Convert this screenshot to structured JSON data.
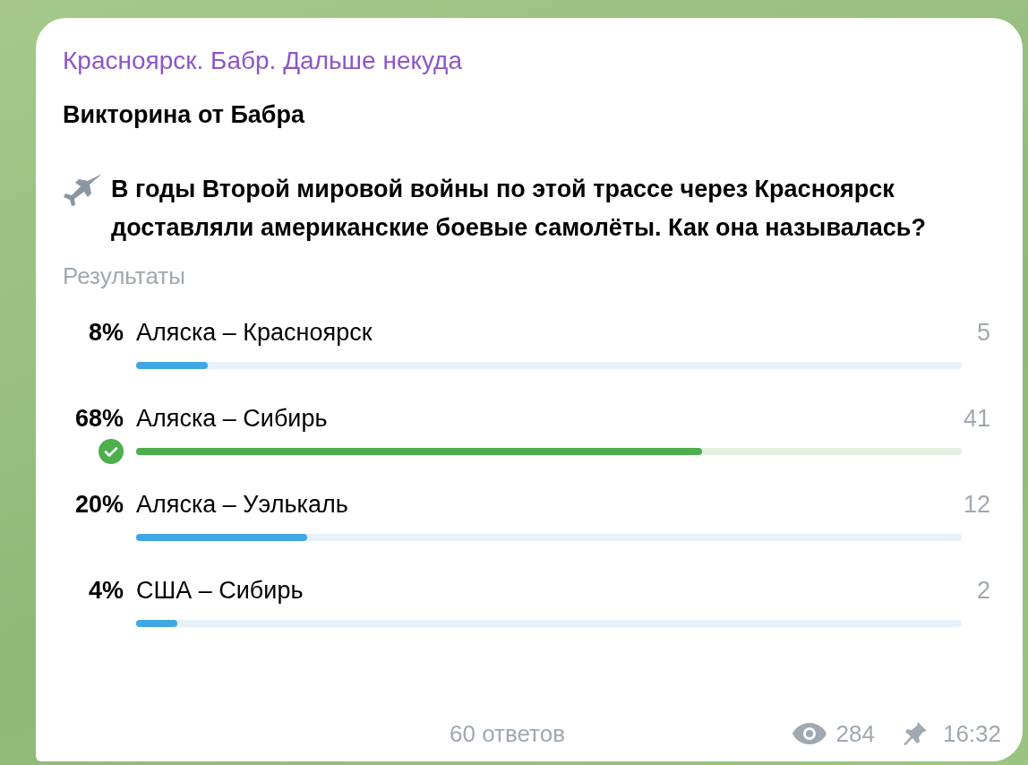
{
  "channel": {
    "title": "Красноярск. Бабр. Дальше некуда"
  },
  "post": {
    "heading": "Викторина от Бабра",
    "question": "В годы Второй мировой войны по этой трассе через Красноярск доставляли американские боевые самолёты. Как она называлась?"
  },
  "poll": {
    "results_label": "Результаты",
    "options": [
      {
        "percent": "8%",
        "label": "Аляска – Красноярск",
        "count": "5",
        "level": 0.087,
        "correct": false
      },
      {
        "percent": "68%",
        "label": "Аляска – Сибирь",
        "count": "41",
        "level": 0.685,
        "correct": true
      },
      {
        "percent": "20%",
        "label": "Аляска – Уэлькаль",
        "count": "12",
        "level": 0.207,
        "correct": false
      },
      {
        "percent": "4%",
        "label": "США – Сибирь",
        "count": "2",
        "level": 0.05,
        "correct": false
      }
    ],
    "total": "60 ответов"
  },
  "footer": {
    "views": "284",
    "time": "16:32"
  }
}
